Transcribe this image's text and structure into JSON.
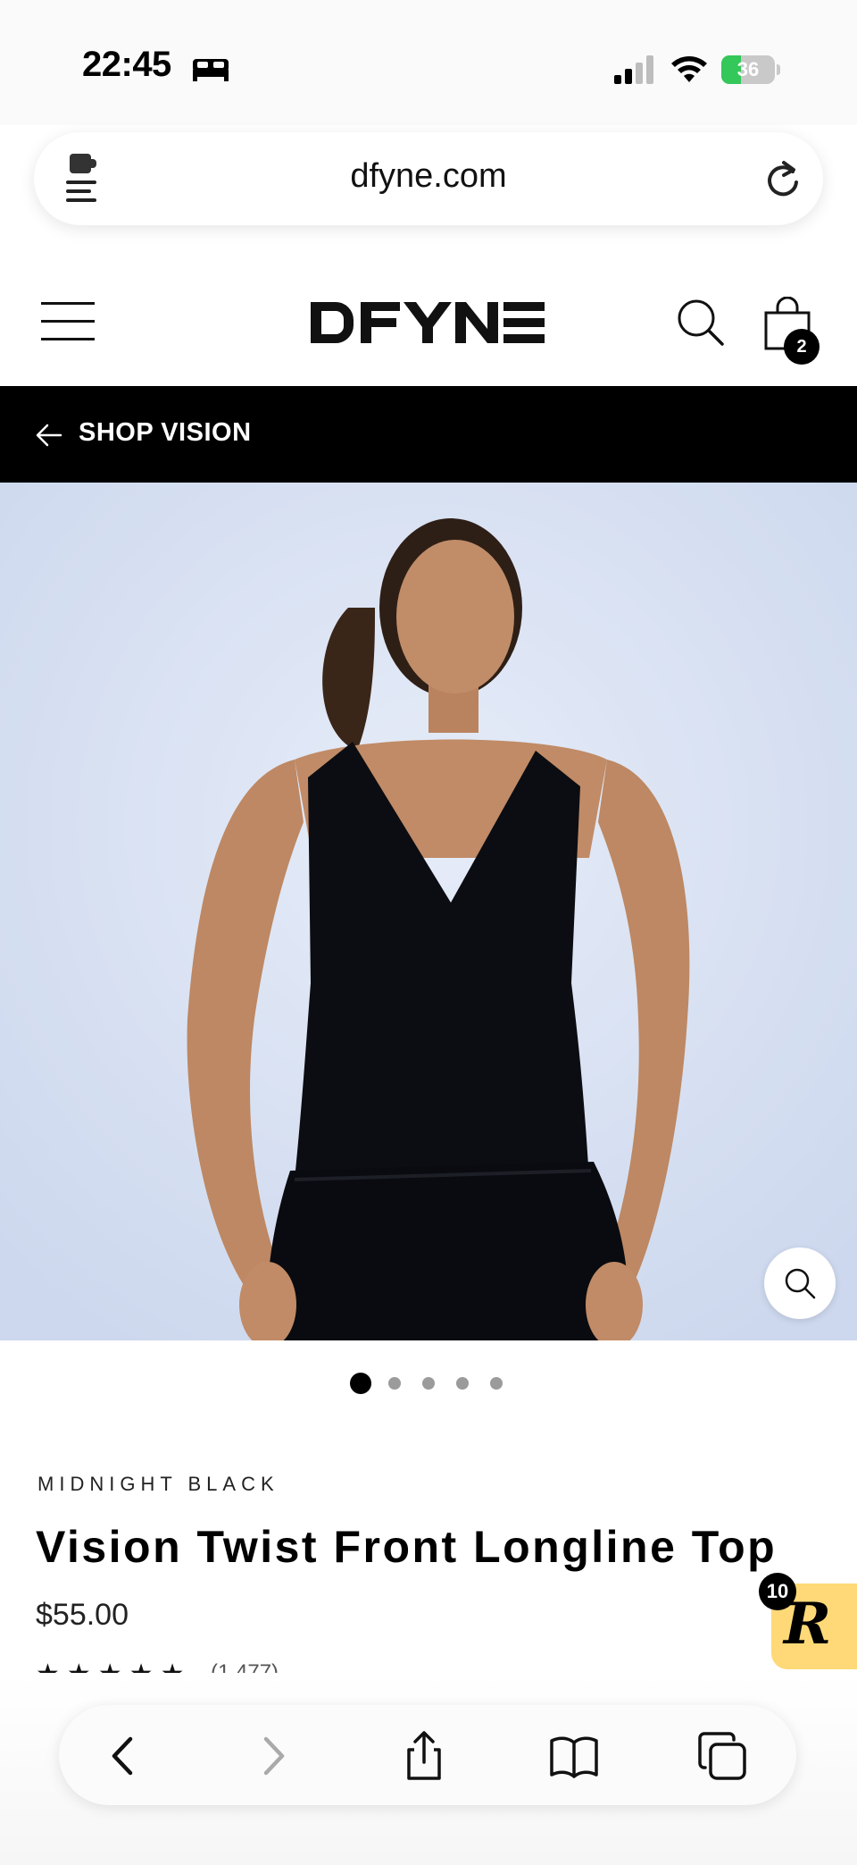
{
  "status_bar": {
    "time": "22:45",
    "battery_percent": "36",
    "battery_level": 0.36,
    "battery_color": "#34c759",
    "icons": [
      "bed-icon",
      "cellular-signal-icon",
      "wifi-icon",
      "battery-charging-icon"
    ]
  },
  "browser": {
    "url": "dfyne.com",
    "icons": [
      "extension-icon",
      "reload-icon"
    ]
  },
  "site_header": {
    "logo_text": "DFYNE",
    "cart_count": "2",
    "icons": [
      "hamburger-menu-icon",
      "search-icon",
      "shopping-bag-icon"
    ]
  },
  "nav": {
    "back_label": "SHOP VISION",
    "icon": "arrow-left-icon"
  },
  "gallery": {
    "active_index": 0,
    "total": 5,
    "background_color": "#d9e2f4",
    "icon": "zoom-icon"
  },
  "product": {
    "variant": "MIDNIGHT BLACK",
    "title": "Vision Twist Front Longline Top",
    "price": "$55.00",
    "rating_stars": "★★★★★",
    "rating_count": "(1,477)"
  },
  "rewards": {
    "badge_count": "10",
    "letter": "R",
    "color": "#ffd977"
  },
  "toolbar": {
    "icons": [
      "back-icon",
      "forward-icon",
      "share-icon",
      "bookmarks-icon",
      "tabs-icon"
    ]
  }
}
